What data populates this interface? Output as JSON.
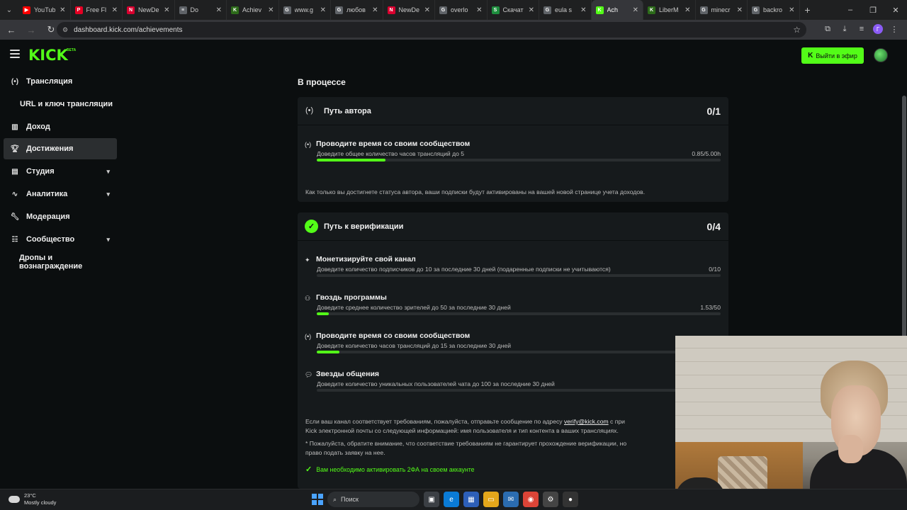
{
  "browser": {
    "tabs": [
      {
        "title": "YouTub",
        "fav": "▶",
        "color": "#ff0000"
      },
      {
        "title": "Free Fl",
        "fav": "P",
        "color": "#e60023"
      },
      {
        "title": "NewDe",
        "fav": "N",
        "color": "#d9002f"
      },
      {
        "title": "Do",
        "fav": "≡",
        "color": "#5f6368"
      },
      {
        "title": "Achiev",
        "fav": "K",
        "color": "#2d6b1a"
      },
      {
        "title": "www.g",
        "fav": "G",
        "color": "#5f6368"
      },
      {
        "title": "любов",
        "fav": "G",
        "color": "#5f6368"
      },
      {
        "title": "NewDe",
        "fav": "N",
        "color": "#d9002f"
      },
      {
        "title": "overlo",
        "fav": "G",
        "color": "#5f6368"
      },
      {
        "title": "Скачат",
        "fav": "S",
        "color": "#1e8e3e"
      },
      {
        "title": "eula s",
        "fav": "G",
        "color": "#5f6368"
      },
      {
        "title": "Ach",
        "fav": "K",
        "color": "#53fc18",
        "active": true
      },
      {
        "title": "LiberM",
        "fav": "K",
        "color": "#2d6b1a"
      },
      {
        "title": "minecr",
        "fav": "G",
        "color": "#5f6368"
      },
      {
        "title": "backro",
        "fav": "G",
        "color": "#5f6368"
      }
    ],
    "url": "dashboard.kick.com/achievements",
    "profile_letter": "Г"
  },
  "header": {
    "logo": "KICK",
    "beta": "BETA",
    "go_live_label": "Выйти в эфир"
  },
  "sidebar": {
    "items": [
      {
        "label": "Трансляция",
        "icon": "broadcast-icon"
      },
      {
        "label": "URL и ключ трансляции",
        "icon": ""
      },
      {
        "label": "Доход",
        "icon": "chart-icon"
      },
      {
        "label": "Достижения",
        "icon": "trophy-icon",
        "active": true
      },
      {
        "label": "Студия",
        "icon": "studio-icon",
        "expandable": true
      },
      {
        "label": "Аналитика",
        "icon": "analytics-icon",
        "expandable": true
      },
      {
        "label": "Модерация",
        "icon": "wrench-icon"
      },
      {
        "label": "Сообщество",
        "icon": "community-icon",
        "expandable": true
      },
      {
        "label": "Дропы и вознаграждение",
        "icon": ""
      }
    ]
  },
  "main": {
    "section_title": "В процессе",
    "author_path": {
      "title": "Путь автора",
      "count": "0/1",
      "tasks": [
        {
          "title": "Проводите время со своим сообществом",
          "desc": "Доведите общее количество часов трансляций до 5",
          "value": "0.85/5.00h",
          "progress": 0.17
        }
      ],
      "note": "Как только вы достигнете статуса автора, ваши подписки будут активированы на вашей новой странице учета доходов."
    },
    "verification_path": {
      "title": "Путь к верификации",
      "count": "0/4",
      "tasks": [
        {
          "title": "Монетизируйте свой канал",
          "desc": "Доведите количество подписчиков до 10 за последние 30 дней (подаренные подписки не учитываются)",
          "value": "0/10",
          "progress": 0.0
        },
        {
          "title": "Гвоздь программы",
          "desc": "Доведите среднее количество зрителей до 50 за последние 30 дней",
          "value": "1.53/50",
          "progress": 0.03
        },
        {
          "title": "Проводите время со своим сообществом",
          "desc": "Доведите количество часов трансляций до 15 за последние 30 дней",
          "value": "",
          "progress": 0.057
        },
        {
          "title": "Звезды общения",
          "desc": "Доведите количество уникальных пользователей чата до 100 за последние 30 дней",
          "value": "",
          "progress": 0.0
        }
      ],
      "note1_a": "Если ваш канал соответствует требованиям, пожалуйста, отправьте сообщение по адресу",
      "note1_email": "verify@kick.com",
      "note1_b": "с при",
      "note1_line2": "Kick электронной почты со следующей информацией: имя пользователя и тип контента в ваших трансляциях.",
      "note2_line1": "* Пожалуйста, обратите внимание, что соответствие требованиям не гарантирует прохождение верификации, но",
      "note2_line2": "право подать заявку на нее.",
      "twofa": "Вам необходимо активировать 2ФА на своем аккаунте"
    }
  },
  "taskbar": {
    "temp": "23°C",
    "weather": "Mostly cloudy",
    "search_placeholder": "Поиск"
  },
  "colors": {
    "accent": "#53fc18",
    "bg": "#0b0e0f",
    "card": "#161a1c"
  }
}
